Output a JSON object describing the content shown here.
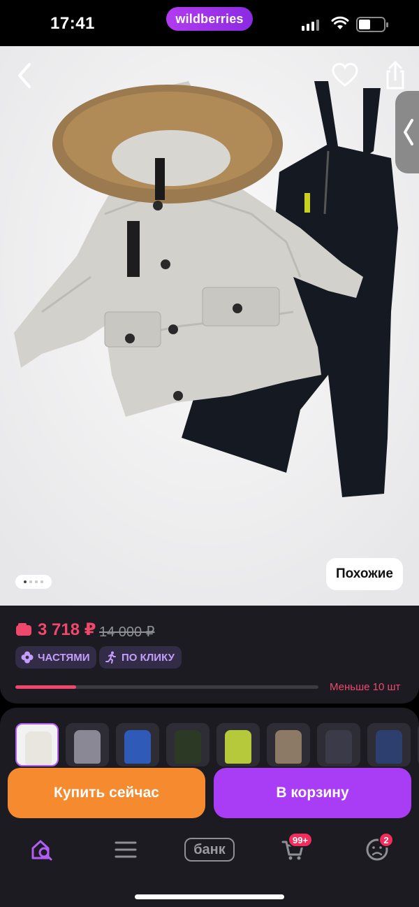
{
  "status_bar": {
    "time": "17:41",
    "brand": "wildberries"
  },
  "product": {
    "image_alt": "Детский зимний комплект: светло-серая куртка с меховым капюшоном и чёрный полукомбинезон",
    "similar_label": "Похожие",
    "gallery": {
      "current": 1,
      "total": 4
    }
  },
  "price": {
    "current": "3 718 ₽",
    "old": "14 000 ₽",
    "badges": [
      {
        "label": "ЧАСТЯМИ",
        "icon": "clover-icon"
      },
      {
        "label": "ПО КЛИКУ",
        "icon": "running-person-icon"
      }
    ],
    "stock_label": "Меньше 10 шт",
    "stock_level": 0.2
  },
  "variants": [
    {
      "color": "#e9e6e0",
      "selected": true
    },
    {
      "color": "#8a8894",
      "selected": false
    },
    {
      "color": "#2f5ab8",
      "selected": false
    },
    {
      "color": "#2c3a25",
      "selected": false
    },
    {
      "color": "#b6c93a",
      "selected": false
    },
    {
      "color": "#8c7a66",
      "selected": false
    },
    {
      "color": "#3a3a48",
      "selected": false
    },
    {
      "color": "#2d3f6e",
      "selected": false
    },
    {
      "color": "#555560",
      "selected": false
    }
  ],
  "actions": {
    "buy_now": "Купить сейчас",
    "add_to_cart": "В корзину"
  },
  "tabbar": {
    "home_icon": "home-search-icon",
    "catalog_icon": "menu-icon",
    "bank_label": "банк",
    "cart_badge": "99+",
    "profile_badge": "2"
  },
  "colors": {
    "accent": "#a93cf5",
    "price": "#f0486d",
    "buy": "#f58a2e",
    "sheet": "#1c1b21"
  }
}
